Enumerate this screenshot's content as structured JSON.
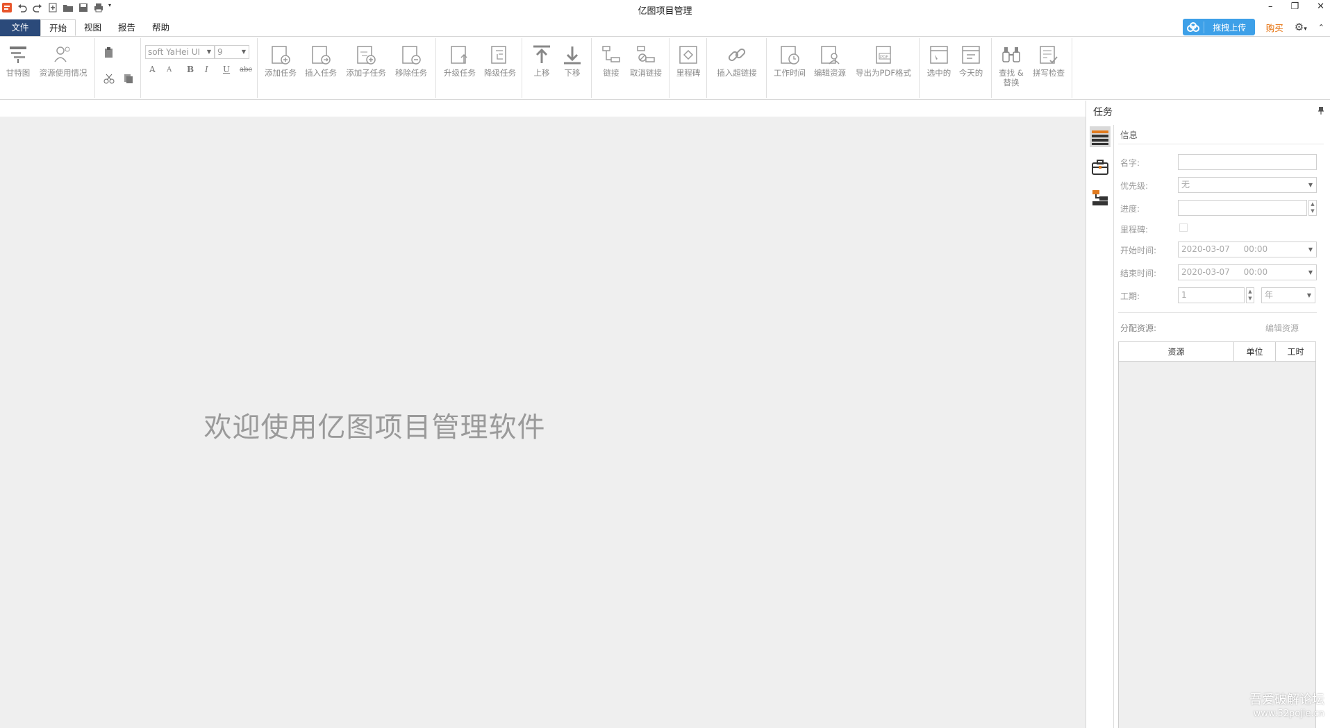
{
  "app": {
    "title": "亿图项目管理"
  },
  "window_controls": {
    "minimize": "–",
    "restore": "❐",
    "close": "✕"
  },
  "menu_tabs": [
    {
      "label": "文件"
    },
    {
      "label": "开始"
    },
    {
      "label": "视图"
    },
    {
      "label": "报告"
    },
    {
      "label": "帮助"
    }
  ],
  "top_right": {
    "upload_label": "拖拽上传",
    "buy_label": "购买",
    "collapse": "⌃",
    "gear": "⚙",
    "gear_caret": "▾"
  },
  "ribbon": {
    "gantt": "甘特图",
    "resource_usage": "资源使用情况",
    "font_name": "soft YaHei UI",
    "font_size": "9",
    "format": {
      "grow": "A",
      "shrink": "A",
      "bold": "B",
      "italic": "I",
      "underline": "U",
      "strike": "abc"
    },
    "add_task": "添加任务",
    "insert_task": "插入任务",
    "add_subtask": "添加子任务",
    "remove_task": "移除任务",
    "upgrade_task": "升级任务",
    "downgrade_task": "降级任务",
    "move_up": "上移",
    "move_down": "下移",
    "link": "链接",
    "unlink": "取消链接",
    "milestone": "里程碑",
    "insert_hyperlink": "插入超链接",
    "work_time": "工作时间",
    "edit_resource": "编辑资源",
    "export_pdf": "导出为PDF格式",
    "selected": "选中的",
    "today": "今天的",
    "find_replace_1": "查找 &",
    "find_replace_2": "替换",
    "spell_check": "拼写检查"
  },
  "canvas": {
    "welcome": "欢迎使用亿图项目管理软件"
  },
  "panel": {
    "title": "任务",
    "pin": "📌",
    "section": "信息",
    "name_label": "名字:",
    "name_value": "",
    "priority_label": "优先级:",
    "priority_value": "无",
    "progress_label": "进度:",
    "progress_value": "",
    "milestone_label": "里程碑:",
    "start_label": "开始时间:",
    "start_date": "2020-03-07",
    "start_time": "00:00",
    "end_label": "结束时间:",
    "end_date": "2020-03-07",
    "end_time": "00:00",
    "duration_label": "工期:",
    "duration_value": "1",
    "duration_unit": "年",
    "assign_label": "分配资源:",
    "edit_resource": "编辑资源",
    "table_headers": [
      "资源",
      "单位",
      "工时"
    ]
  },
  "watermark": {
    "line1": "吾爱破解论坛",
    "line2": "www.52pojie.cn"
  }
}
